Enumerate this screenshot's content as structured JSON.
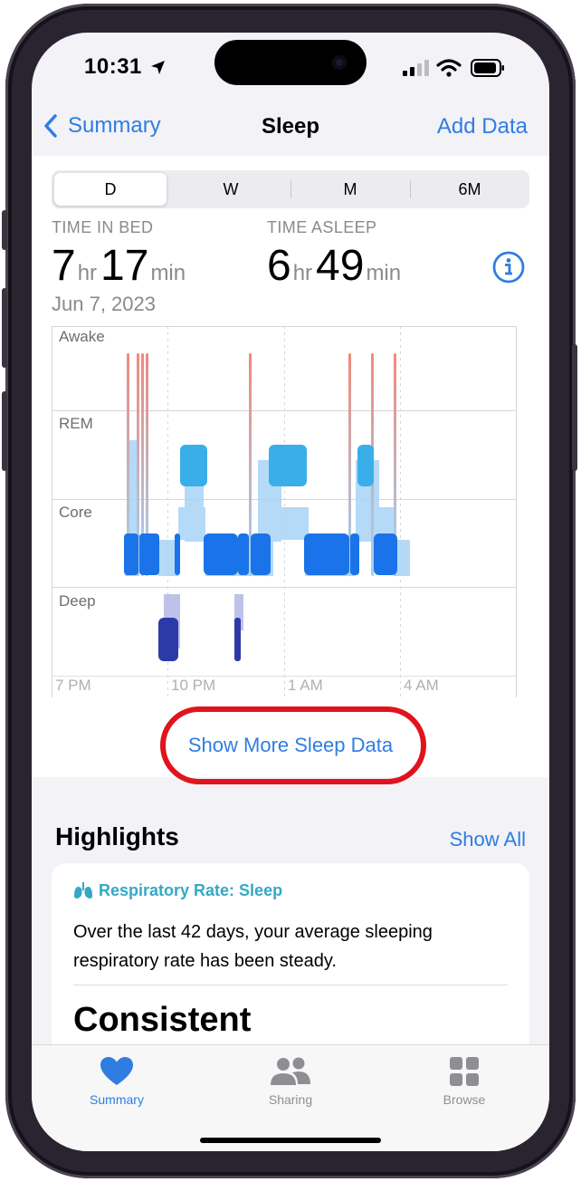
{
  "status": {
    "time": "10:31"
  },
  "nav": {
    "back": "Summary",
    "title": "Sleep",
    "action": "Add Data"
  },
  "segments": [
    {
      "label": "D",
      "selected": true
    },
    {
      "label": "W"
    },
    {
      "label": "M"
    },
    {
      "label": "6M"
    }
  ],
  "metrics": {
    "in_bed": {
      "label": "TIME IN BED",
      "hours": "7",
      "hr_unit": "hr",
      "minutes": "17",
      "min_unit": "min"
    },
    "asleep": {
      "label": "TIME ASLEEP",
      "hours": "6",
      "hr_unit": "hr",
      "minutes": "49",
      "min_unit": "min"
    },
    "date": "Jun 7, 2023"
  },
  "chart": {
    "stages": [
      "Awake",
      "REM",
      "Core",
      "Deep"
    ],
    "x_ticks": [
      "7 PM",
      "10 PM",
      "1 AM",
      "4 AM"
    ],
    "colors": {
      "awake": "#f08a7a",
      "rem": "#3aaee8",
      "core": "#1a73e8",
      "deep": "#2c3aa8"
    }
  },
  "more_link": "Show More Sleep Data",
  "highlights": {
    "title": "Highlights",
    "show_all": "Show All",
    "card": {
      "heading": "Respiratory Rate: Sleep",
      "body": "Over the last 42 days, your average sleeping respiratory rate has been steady.",
      "value": "Consistent"
    }
  },
  "tabs": [
    {
      "label": "Summary",
      "icon": "heart-icon"
    },
    {
      "label": "Sharing",
      "icon": "people-icon"
    },
    {
      "label": "Browse",
      "icon": "grid-icon"
    }
  ]
}
